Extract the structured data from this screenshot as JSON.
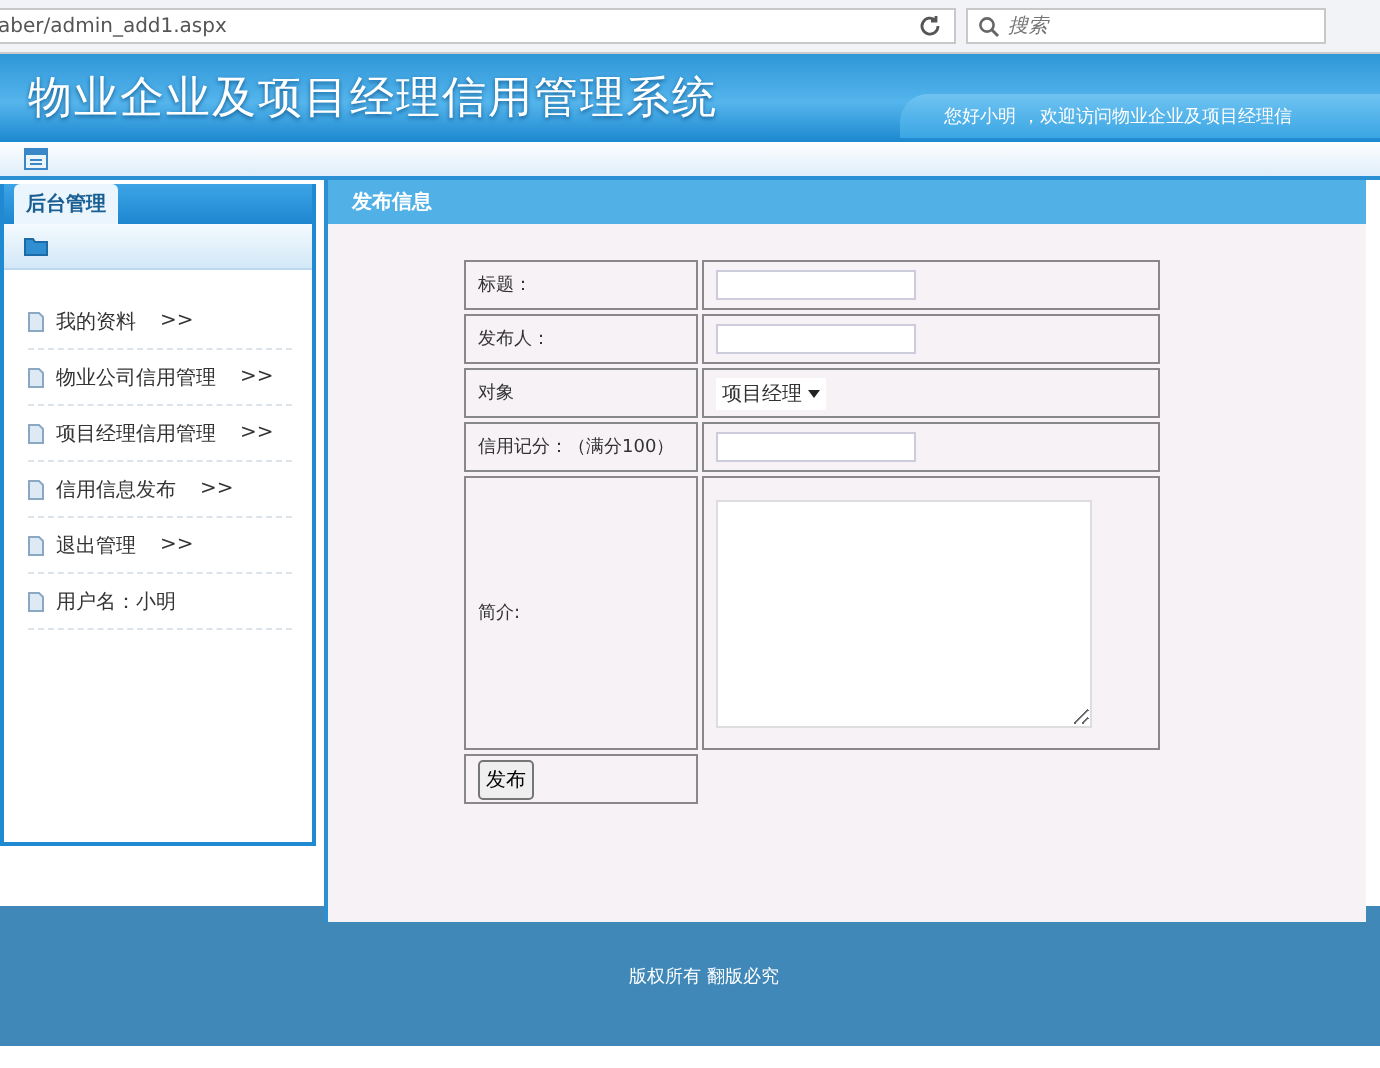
{
  "browser": {
    "url": "aber/admin_add1.aspx",
    "search_placeholder": "搜索"
  },
  "header": {
    "title": "物业企业及项目经理信用管理系统",
    "welcome": "您好小明 ，欢迎访问物业企业及项目经理信"
  },
  "sidebar": {
    "tab": "后台管理",
    "items": [
      {
        "label": "我的资料",
        "arrow": ">>"
      },
      {
        "label": "物业公司信用管理",
        "arrow": ">>"
      },
      {
        "label": "项目经理信用管理",
        "arrow": ">>"
      },
      {
        "label": "信用信息发布",
        "arrow": ">>"
      },
      {
        "label": "退出管理",
        "arrow": ">>"
      },
      {
        "label": "用户名：小明"
      }
    ]
  },
  "content": {
    "title": "发布信息",
    "fields": [
      {
        "label": "标题：",
        "kind": "text"
      },
      {
        "label": "发布人：",
        "kind": "text"
      },
      {
        "label": "对象",
        "kind": "select",
        "value": "项目经理"
      },
      {
        "label": "信用记分：（满分100）",
        "kind": "text"
      },
      {
        "label": "简介:",
        "kind": "textarea"
      }
    ],
    "submit": "发布"
  },
  "footer": {
    "text": "版权所有 翻版必究"
  }
}
